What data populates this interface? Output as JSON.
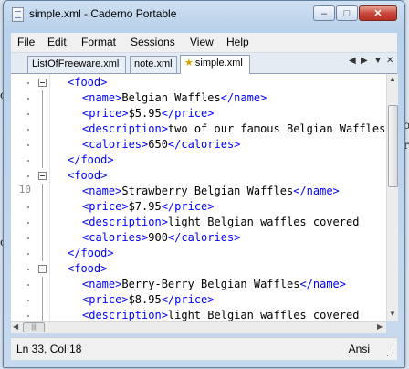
{
  "window": {
    "title": "simple.xml - Caderno Portable",
    "caption_buttons": {
      "minimize": "–",
      "maximize": "□",
      "close": "✕"
    }
  },
  "background_fragments": {
    "left_a": "o",
    "left_b": "or",
    "right_a": "o",
    "right_b": "r"
  },
  "menu": [
    "File",
    "Edit",
    "Format",
    "Sessions",
    "View",
    "Help"
  ],
  "tabs": [
    {
      "label": "ListOfFreeware.xml",
      "active": false
    },
    {
      "label": "note.xml",
      "active": false
    },
    {
      "label": "simple.xml",
      "active": true
    }
  ],
  "tab_controls": {
    "prev": "◀",
    "next": "▶",
    "menu": "▼",
    "close": "✕"
  },
  "editor": {
    "line_numbers": [
      "10"
    ],
    "lines": [
      {
        "indent": 0,
        "parts": [
          {
            "t": "tag",
            "v": "<food>"
          }
        ]
      },
      {
        "indent": 1,
        "parts": [
          {
            "t": "tag",
            "v": "<name>"
          },
          {
            "t": "txt",
            "v": "Belgian Waffles"
          },
          {
            "t": "tag",
            "v": "</name>"
          }
        ]
      },
      {
        "indent": 1,
        "parts": [
          {
            "t": "tag",
            "v": "<price>"
          },
          {
            "t": "txt",
            "v": "$5.95"
          },
          {
            "t": "tag",
            "v": "</price>"
          }
        ]
      },
      {
        "indent": 1,
        "parts": [
          {
            "t": "tag",
            "v": "<description>"
          },
          {
            "t": "txt",
            "v": "two of our famous Belgian Waffles"
          }
        ]
      },
      {
        "indent": 1,
        "parts": [
          {
            "t": "tag",
            "v": "<calories>"
          },
          {
            "t": "txt",
            "v": "650"
          },
          {
            "t": "tag",
            "v": "</calories>"
          }
        ]
      },
      {
        "indent": 0,
        "parts": [
          {
            "t": "tag",
            "v": "</food>"
          }
        ]
      },
      {
        "indent": 0,
        "parts": [
          {
            "t": "tag",
            "v": "<food>"
          }
        ]
      },
      {
        "indent": 1,
        "parts": [
          {
            "t": "tag",
            "v": "<name>"
          },
          {
            "t": "txt",
            "v": "Strawberry Belgian Waffles"
          },
          {
            "t": "tag",
            "v": "</name>"
          }
        ]
      },
      {
        "indent": 1,
        "parts": [
          {
            "t": "tag",
            "v": "<price>"
          },
          {
            "t": "txt",
            "v": "$7.95"
          },
          {
            "t": "tag",
            "v": "</price>"
          }
        ]
      },
      {
        "indent": 1,
        "parts": [
          {
            "t": "tag",
            "v": "<description>"
          },
          {
            "t": "txt",
            "v": "light Belgian waffles covered"
          }
        ]
      },
      {
        "indent": 1,
        "parts": [
          {
            "t": "tag",
            "v": "<calories>"
          },
          {
            "t": "txt",
            "v": "900"
          },
          {
            "t": "tag",
            "v": "</calories>"
          }
        ]
      },
      {
        "indent": 0,
        "parts": [
          {
            "t": "tag",
            "v": "</food>"
          }
        ]
      },
      {
        "indent": 0,
        "parts": [
          {
            "t": "tag",
            "v": "<food>"
          }
        ]
      },
      {
        "indent": 1,
        "parts": [
          {
            "t": "tag",
            "v": "<name>"
          },
          {
            "t": "txt",
            "v": "Berry-Berry Belgian Waffles"
          },
          {
            "t": "tag",
            "v": "</name>"
          }
        ]
      },
      {
        "indent": 1,
        "parts": [
          {
            "t": "tag",
            "v": "<price>"
          },
          {
            "t": "txt",
            "v": "$8.95"
          },
          {
            "t": "tag",
            "v": "</price>"
          }
        ]
      },
      {
        "indent": 1,
        "parts": [
          {
            "t": "tag",
            "v": "<description>"
          },
          {
            "t": "txt",
            "v": "light Belgian waffles covered"
          }
        ]
      }
    ]
  },
  "scrollbars": {
    "up": "▲",
    "down": "▼",
    "left": "◀",
    "right": "▶",
    "grip": "|||"
  },
  "status": {
    "position": "Ln 33, Col 18",
    "encoding": "Ansi",
    "resize_grip": "⋰"
  },
  "colors": {
    "tag": "#0000ff",
    "text": "#000000",
    "line_number": "#8a8a8a",
    "close_button": "#c9473a"
  }
}
